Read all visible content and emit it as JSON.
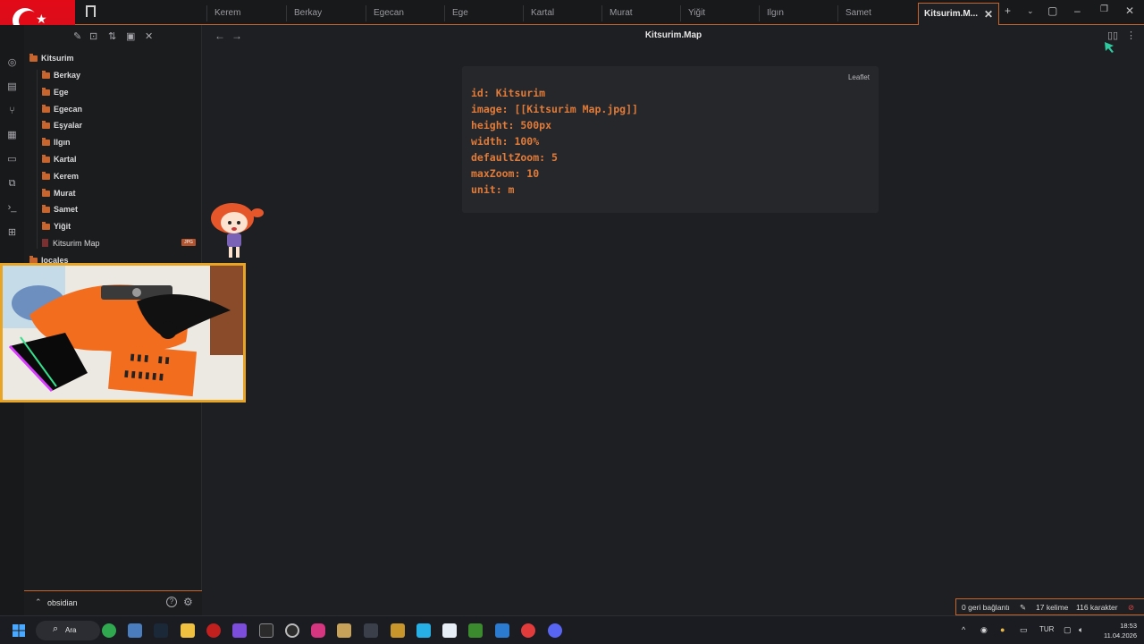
{
  "tabs": [
    {
      "label": "Kerem"
    },
    {
      "label": "Berkay"
    },
    {
      "label": "Egecan"
    },
    {
      "label": "Ege"
    },
    {
      "label": "Kartal"
    },
    {
      "label": "Murat"
    },
    {
      "label": "Yiğit"
    },
    {
      "label": "Ilgın"
    },
    {
      "label": "Samet"
    }
  ],
  "active_tab": {
    "label": "Kitsurim.M..."
  },
  "sidebar": {
    "root": "Kitsurim",
    "folders": [
      "Berkay",
      "Ege",
      "Egecan",
      "Eşyalar",
      "Ilgın",
      "Kartal",
      "Kerem",
      "Murat",
      "Samet",
      "Yiğit"
    ],
    "file": {
      "label": "Kitsurim Map",
      "badge": "JPG"
    },
    "next_folder": "locales"
  },
  "vault": {
    "name": "obsidian"
  },
  "editor": {
    "title": "Kitsurim.Map",
    "code_language": "Leaflet",
    "code_lines": [
      "id: Kitsurim",
      "image: [[Kitsurim Map.jpg]]",
      "height: 500px",
      "width: 100%",
      "defaultZoom: 5",
      "maxZoom: 10",
      "unit: m"
    ]
  },
  "status": {
    "backlinks": "0 geri bağlantı",
    "words": "17 kelime",
    "chars": "116 karakter"
  },
  "taskbar": {
    "search_label": "Ara",
    "lang": "TUR",
    "time": "18:53",
    "date": "11.04.2026"
  },
  "colors": {
    "accent": "#c8652f",
    "code_text": "#e07b39",
    "background": "#1e1f22"
  }
}
